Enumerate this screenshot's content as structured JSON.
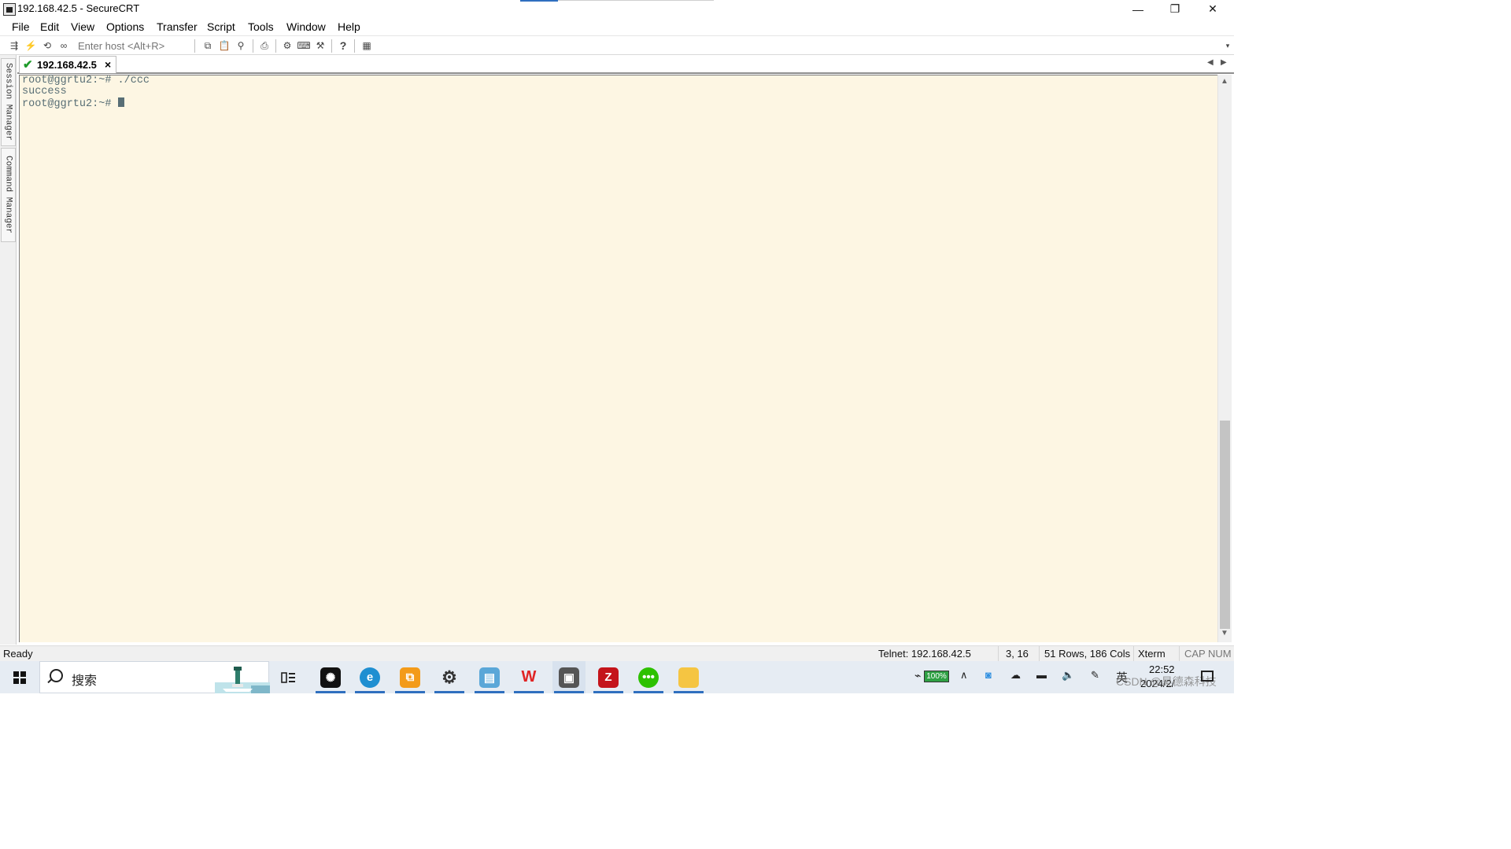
{
  "window": {
    "title": "192.168.42.5 - SecureCRT",
    "minimize_glyph": "—",
    "restore_glyph": "❐",
    "close_glyph": "✕"
  },
  "menu": [
    "File",
    "Edit",
    "View",
    "Options",
    "Transfer",
    "Script",
    "Tools",
    "Window",
    "Help"
  ],
  "toolbar": {
    "host_placeholder": "Enter host <Alt+R>",
    "icons": [
      "connect-icon",
      "quick-connect-icon",
      "reconnect-icon",
      "disconnect-icon",
      "copy-icon",
      "paste-icon",
      "find-icon",
      "print-icon",
      "settings-icon",
      "keymap-icon",
      "tools-icon",
      "help-icon",
      "sftp-icon"
    ]
  },
  "side_panel": {
    "session_manager": "Session Manager",
    "command_manager": "Command Manager"
  },
  "tab": {
    "label": "192.168.42.5",
    "close_glyph": "×"
  },
  "terminal": {
    "lines": [
      "root@ggrtu2:~# ./ccc",
      "success",
      "root@ggrtu2:~# "
    ],
    "background": "#fdf6e3",
    "foreground": "#586e75"
  },
  "status": {
    "ready": "Ready",
    "connection": "Telnet: 192.168.42.5",
    "cursor_pos": "3, 16",
    "size": "51 Rows, 186 Cols",
    "terminal_type": "Xterm",
    "cap": "CAP",
    "num": "NUM"
  },
  "taskbar": {
    "search_text": "搜索",
    "battery": "100%",
    "ime": "英",
    "time": "22:52",
    "date": "2024/2/",
    "watermark": "CSDN @昊德森科技"
  }
}
